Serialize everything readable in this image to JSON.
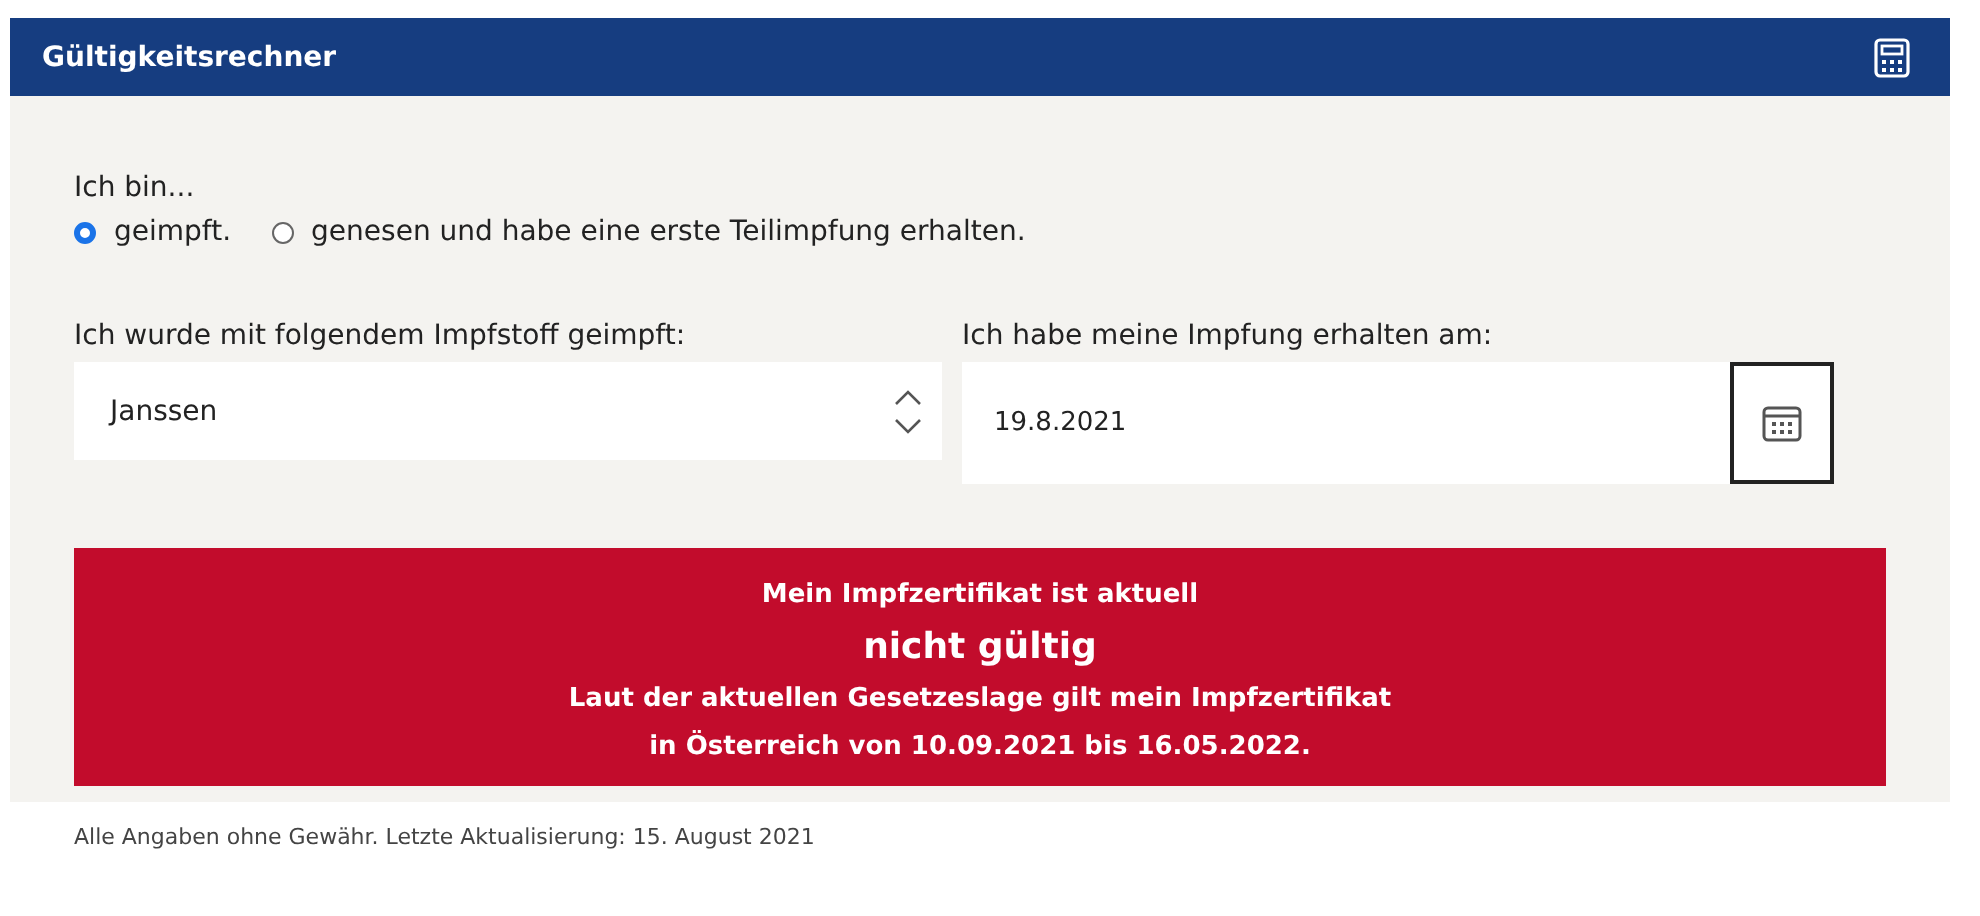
{
  "header": {
    "title": "Gültigkeitsrechner"
  },
  "status_question": {
    "label": "Ich bin...",
    "options": [
      {
        "label": "geimpft.",
        "selected": true
      },
      {
        "label": "genesen und habe eine erste Teilimpfung erhalten.",
        "selected": false
      }
    ]
  },
  "vaccine": {
    "label": "Ich wurde mit folgendem Impfstoff geimpft:",
    "value": "Janssen"
  },
  "vaccination_date": {
    "label": "Ich habe meine Impfung erhalten am:",
    "value": "19.8.2021"
  },
  "result": {
    "valid": false,
    "intro": "Mein Impfzertifikat ist aktuell",
    "verdict": "nicht gültig",
    "detail_lines": [
      "Laut der aktuellen Gesetzeslage gilt mein Impfzertifikat",
      "in Österreich von 10.09.2021 bis 16.05.2022."
    ]
  },
  "footer_note": "Alle Angaben ohne Gewähr. Letzte Aktualisierung: 15. August 2021"
}
